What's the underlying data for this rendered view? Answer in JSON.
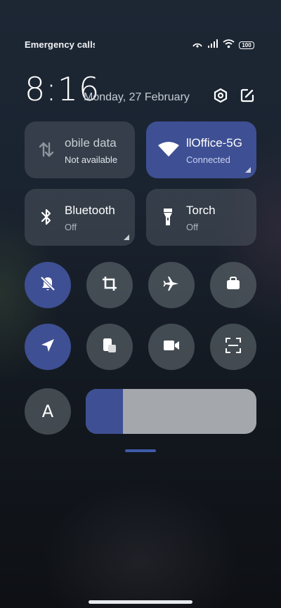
{
  "status_bar": {
    "carrier_text": "Emergency calls o",
    "battery_level": "100",
    "icons": [
      "hotspot-icon",
      "signal-icon",
      "wifi-icon",
      "battery-icon"
    ]
  },
  "header": {
    "time": "8:16",
    "date": "Monday, 27 February",
    "settings_icon": "settings-hex-icon",
    "edit_icon": "edit-icon"
  },
  "tiles": {
    "mobile_data": {
      "title": "obile data",
      "subtitle": "Not available",
      "icon": "mobile-data-arrows-icon",
      "active": false
    },
    "wifi": {
      "title": "llOffice-5G",
      "subtitle": "Connected",
      "icon": "wifi-icon",
      "active": true
    },
    "bluetooth": {
      "title": "Bluetooth",
      "subtitle": "Off",
      "icon": "bluetooth-icon",
      "active": false
    },
    "torch": {
      "title": "Torch",
      "subtitle": "Off",
      "icon": "torch-icon",
      "active": false
    }
  },
  "toggles_row1": [
    {
      "name": "mute-icon",
      "active": true
    },
    {
      "name": "crop-screenshot-icon",
      "active": false
    },
    {
      "name": "airplane-icon",
      "active": false
    },
    {
      "name": "work-briefcase-icon",
      "active": false
    }
  ],
  "toggles_row2": [
    {
      "name": "location-icon",
      "active": true
    },
    {
      "name": "floating-window-icon",
      "active": false
    },
    {
      "name": "screen-record-icon",
      "active": false
    },
    {
      "name": "scanner-icon",
      "active": false
    }
  ],
  "auto_brightness": {
    "label": "A"
  },
  "brightness": {
    "level_fraction": 0.22
  },
  "colors": {
    "accent": "#3e4f93",
    "tile_inactive": "#4a535d",
    "slider_track": "#a4a7ab"
  }
}
